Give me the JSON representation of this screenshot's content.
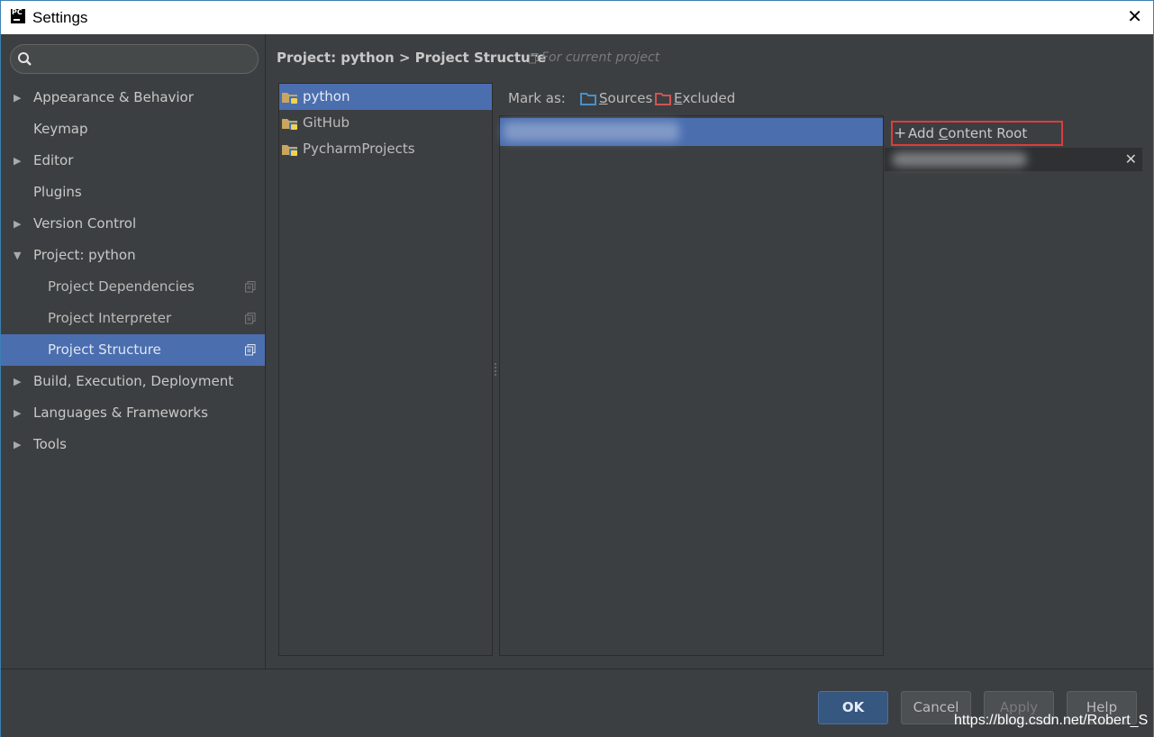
{
  "window": {
    "title": "Settings",
    "app_icon_text": "PC",
    "close_glyph": "✕"
  },
  "sidebar": {
    "search": {
      "placeholder": "",
      "value": ""
    },
    "items": [
      {
        "label": "Appearance & Behavior",
        "arrow": "▶"
      },
      {
        "label": "Keymap",
        "arrow": ""
      },
      {
        "label": "Editor",
        "arrow": "▶"
      },
      {
        "label": "Plugins",
        "arrow": ""
      },
      {
        "label": "Version Control",
        "arrow": "▶"
      },
      {
        "label": "Project: python",
        "arrow": "▼"
      },
      {
        "label": "Project Dependencies"
      },
      {
        "label": "Project Interpreter"
      },
      {
        "label": "Project Structure"
      },
      {
        "label": "Build, Execution, Deployment",
        "arrow": "▶"
      },
      {
        "label": "Languages & Frameworks",
        "arrow": "▶"
      },
      {
        "label": "Tools",
        "arrow": "▶"
      }
    ]
  },
  "header": {
    "breadcrumb": "Project: python > Project Structure",
    "scope_note": "For current project"
  },
  "projects": [
    {
      "name": "python"
    },
    {
      "name": "GitHub"
    },
    {
      "name": "PycharmProjects"
    }
  ],
  "markbar": {
    "label": "Mark as:",
    "sources": "Sources",
    "excluded": "Excluded"
  },
  "roots": {
    "add_plus": "+",
    "add_label": "Add Content Root",
    "remove_glyph": "✕"
  },
  "buttons": {
    "ok": "OK",
    "cancel": "Cancel",
    "apply": "Apply",
    "help": "Help"
  },
  "watermark": "https://blog.csdn.net/Robert_S",
  "colors": {
    "selection": "#4b6eaf",
    "background": "#3c3f41",
    "highlight_border": "#e03b3b",
    "sources_folder": "#4a90c8",
    "excluded_folder": "#d05454"
  }
}
